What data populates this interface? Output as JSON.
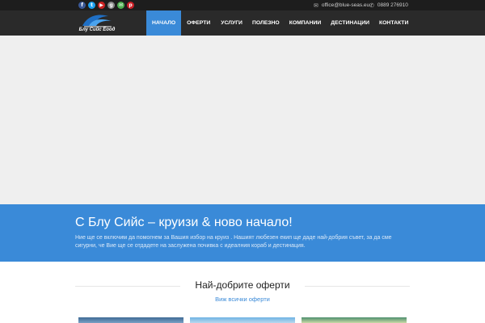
{
  "topbar": {
    "socials": [
      {
        "name": "facebook",
        "glyph": "f",
        "color": "#3b5998"
      },
      {
        "name": "twitter",
        "glyph": "t",
        "color": "#1da1f2"
      },
      {
        "name": "youtube",
        "glyph": "▶",
        "color": "#cc2222"
      },
      {
        "name": "google-plus",
        "glyph": "g",
        "color": "#8a8a8a"
      },
      {
        "name": "email",
        "glyph": "✉",
        "color": "#4caf50"
      },
      {
        "name": "pinterest",
        "glyph": "p",
        "color": "#cb2027"
      }
    ],
    "email": "office@blue-seas.eu",
    "phone": "0889 276910"
  },
  "logo": {
    "text": "Блу Сийс Еоод"
  },
  "nav": {
    "items": [
      {
        "label": "НАЧАЛО",
        "active": true
      },
      {
        "label": "ОФЕРТИ",
        "active": false
      },
      {
        "label": "УСЛУГИ",
        "active": false
      },
      {
        "label": "ПОЛЕЗНО",
        "active": false
      },
      {
        "label": "КОМПАНИИ",
        "active": false
      },
      {
        "label": "ДЕСТИНАЦИИ",
        "active": false
      },
      {
        "label": "КОНТАКТИ",
        "active": false
      }
    ]
  },
  "intro": {
    "title": "С Блу Сийс – круизи & ново начало!",
    "text": "Ние ще се включим да помогнем за Вашия избор на круиз . Нашият любезен екип ще даде най-добрия съвет, за да сме сигурни, че Вие ще се отдадете на заслужена почивка с идеалния кораб и дестинация."
  },
  "offers": {
    "title": "Най-добрите оферти",
    "link": "Виж всички оферти"
  },
  "colors": {
    "accent": "#3a8ad8",
    "topbar": "#1d1d1d",
    "navbar": "#2a2a2a"
  }
}
